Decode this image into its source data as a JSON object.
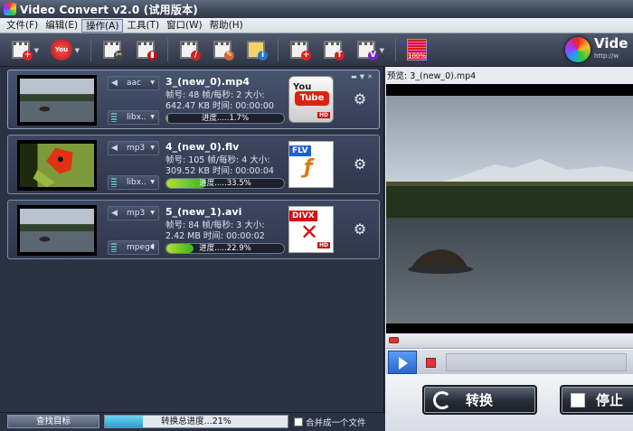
{
  "window": {
    "title": "Video Convert v2.0 (试用版本)"
  },
  "menu": [
    {
      "label": "文件(F)"
    },
    {
      "label": "编辑(E)"
    },
    {
      "label": "操作(A)"
    },
    {
      "label": "工具(T)"
    },
    {
      "label": "窗口(W)"
    },
    {
      "label": "帮助(H)"
    }
  ],
  "toolbar": {
    "youtube_small": "You",
    "percent_label": "100%"
  },
  "logo": {
    "text": "Vide",
    "url": "http://w"
  },
  "tasks": [
    {
      "filename": "3_(new_0).mp4",
      "audio_codec": "aac",
      "video_codec": "libx..",
      "info": "帧号: 48 帧/每秒: 2 大小: 642.47 KB 时间: 00:00:00",
      "progress_label": "进度.....1.7%",
      "progress": 0.017,
      "output": "YouTube",
      "output_line1": "You",
      "output_line2": "Tube",
      "hd": "HD"
    },
    {
      "filename": "4_(new_0).flv",
      "audio_codec": "mp3",
      "video_codec": "libx..",
      "info": "帧号: 105 帧/每秒: 4 大小: 309.52 KB 时间: 00:00:04",
      "progress_label": "进度.....33.5%",
      "progress": 0.335,
      "output": "FLV",
      "output_line1": "FLV",
      "output_line2": "ƒ",
      "hd": ""
    },
    {
      "filename": "5_(new_1).avi",
      "audio_codec": "mp3",
      "video_codec": "mpeg4",
      "info": "帧号: 84 帧/每秒: 3 大小: 2.42 MB 时间: 00:00:02",
      "progress_label": "进度.....22.9%",
      "progress": 0.229,
      "output": "DIVX",
      "output_line1": "DIVX",
      "output_line2": "✕",
      "hd": "HD"
    }
  ],
  "preview": {
    "title": "预览: 3_(new_0).mp4"
  },
  "actions": {
    "convert_label": "转换",
    "stop_label": "停止"
  },
  "status": {
    "find_target": "查找目标",
    "total_label": "转换总进度...21%",
    "total_progress": 0.21,
    "merge_label": "合并成一个文件"
  }
}
